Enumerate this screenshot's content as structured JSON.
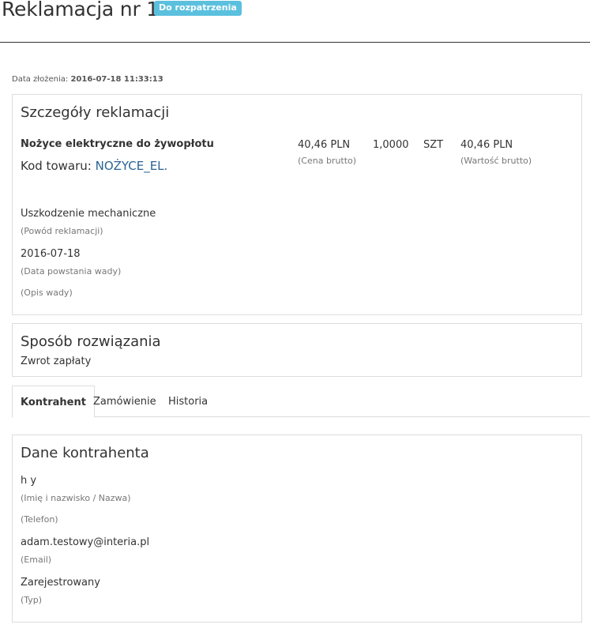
{
  "header": {
    "title": "Reklamacja nr 1",
    "status_badge": "Do rozpatrzenia"
  },
  "submit_date": {
    "label": "Data złożenia:",
    "value": "2016-07-18 11:33:13"
  },
  "details": {
    "title": "Szczegóły reklamacji",
    "product_name": "Nożyce elektryczne do żywopłotu",
    "product_code_label": "Kod towaru:",
    "product_code_value": "NOŻYCE_EL.",
    "gross_price": "40,46 PLN",
    "gross_price_label": "(Cena brutto)",
    "quantity": "1,0000",
    "unit": "SZT",
    "gross_value": "40,46 PLN",
    "gross_value_label": "(Wartość brutto)",
    "reason_value": "Uszkodzenie mechaniczne",
    "reason_label": "(Powód reklamacji)",
    "defect_date_value": "2016-07-18",
    "defect_date_label": "(Data powstania wady)",
    "defect_description_label": "(Opis wady)"
  },
  "solution": {
    "title": "Sposób rozwiązania",
    "value": "Zwrot zapłaty"
  },
  "tabs": [
    {
      "label": "Kontrahent",
      "active": true
    },
    {
      "label": "Zamówienie",
      "active": false
    },
    {
      "label": "Historia",
      "active": false
    }
  ],
  "contractor": {
    "title": "Dane kontrahenta",
    "name_value": "h y",
    "name_label": "(Imię i nazwisko / Nazwa)",
    "phone_label": "(Telefon)",
    "email_value": "adam.testowy@interia.pl",
    "email_label": "(Email)",
    "type_value": "Zarejestrowany",
    "type_label": "(Typ)"
  },
  "colors": {
    "badge": "#5bc0de",
    "link": "#2a6496",
    "muted": "#777777"
  }
}
